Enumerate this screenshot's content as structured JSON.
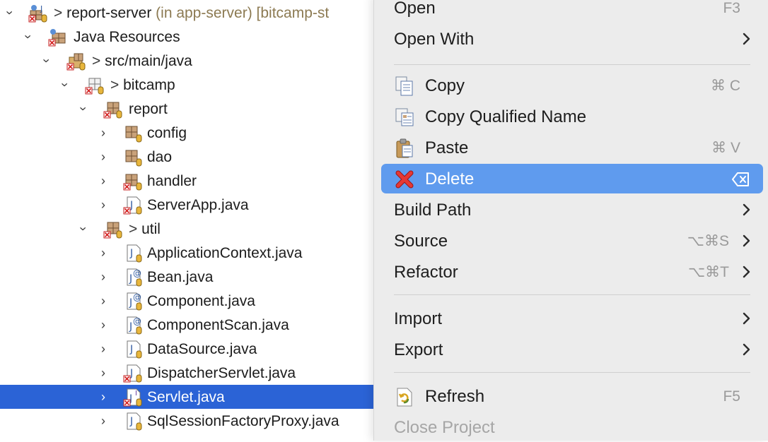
{
  "tree": {
    "rows": [
      {
        "name": "report-server",
        "decorator": "(in app-server) [bitcamp-st",
        "dirty": true
      },
      {
        "name": "Java Resources"
      },
      {
        "name": "src/main/java",
        "dirty": true
      },
      {
        "name": "bitcamp",
        "dirty": true
      },
      {
        "name": "report"
      },
      {
        "name": "config"
      },
      {
        "name": "dao"
      },
      {
        "name": "handler"
      },
      {
        "name": "ServerApp.java"
      },
      {
        "name": "util",
        "dirty": true
      },
      {
        "name": "ApplicationContext.java"
      },
      {
        "name": "Bean.java"
      },
      {
        "name": "Component.java"
      },
      {
        "name": "ComponentScan.java"
      },
      {
        "name": "DataSource.java"
      },
      {
        "name": "DispatcherServlet.java"
      },
      {
        "name": "Servlet.java",
        "selected": true
      },
      {
        "name": "SqlSessionFactoryProxy.java"
      }
    ]
  },
  "menu": {
    "items": [
      {
        "label": "Open",
        "shortcut": "F3"
      },
      {
        "label": "Open With"
      },
      {
        "label": "Copy",
        "shortcut": "⌘ C"
      },
      {
        "label": "Copy Qualified Name"
      },
      {
        "label": "Paste",
        "shortcut": "⌘ V"
      },
      {
        "label": "Delete"
      },
      {
        "label": "Build Path"
      },
      {
        "label": "Source",
        "shortcut": "⌥⌘S"
      },
      {
        "label": "Refactor",
        "shortcut": "⌥⌘T"
      },
      {
        "label": "Import"
      },
      {
        "label": "Export"
      },
      {
        "label": "Refresh",
        "shortcut": "F5"
      },
      {
        "label": "Close Project"
      }
    ]
  },
  "colors": {
    "selection": "#2b63d6",
    "menu_highlight": "#5f9bee",
    "menu_background": "#ececec",
    "decorator": "#8c7a52"
  },
  "icons": {
    "project": "java-project-icon",
    "source_folder": "source-folder-icon",
    "package": "package-icon",
    "java_file": "java-file-icon",
    "annotation_file": "annotation-file-icon",
    "interface_file": "interface-file-icon",
    "error_overlay": "error-overlay-icon",
    "copy": "copy-icon",
    "copy_qualified": "copy-qualified-name-icon",
    "paste": "paste-icon",
    "delete": "delete-icon",
    "refresh": "refresh-icon",
    "submenu": "chevron-right-icon",
    "delete_key": "delete-key-icon"
  }
}
